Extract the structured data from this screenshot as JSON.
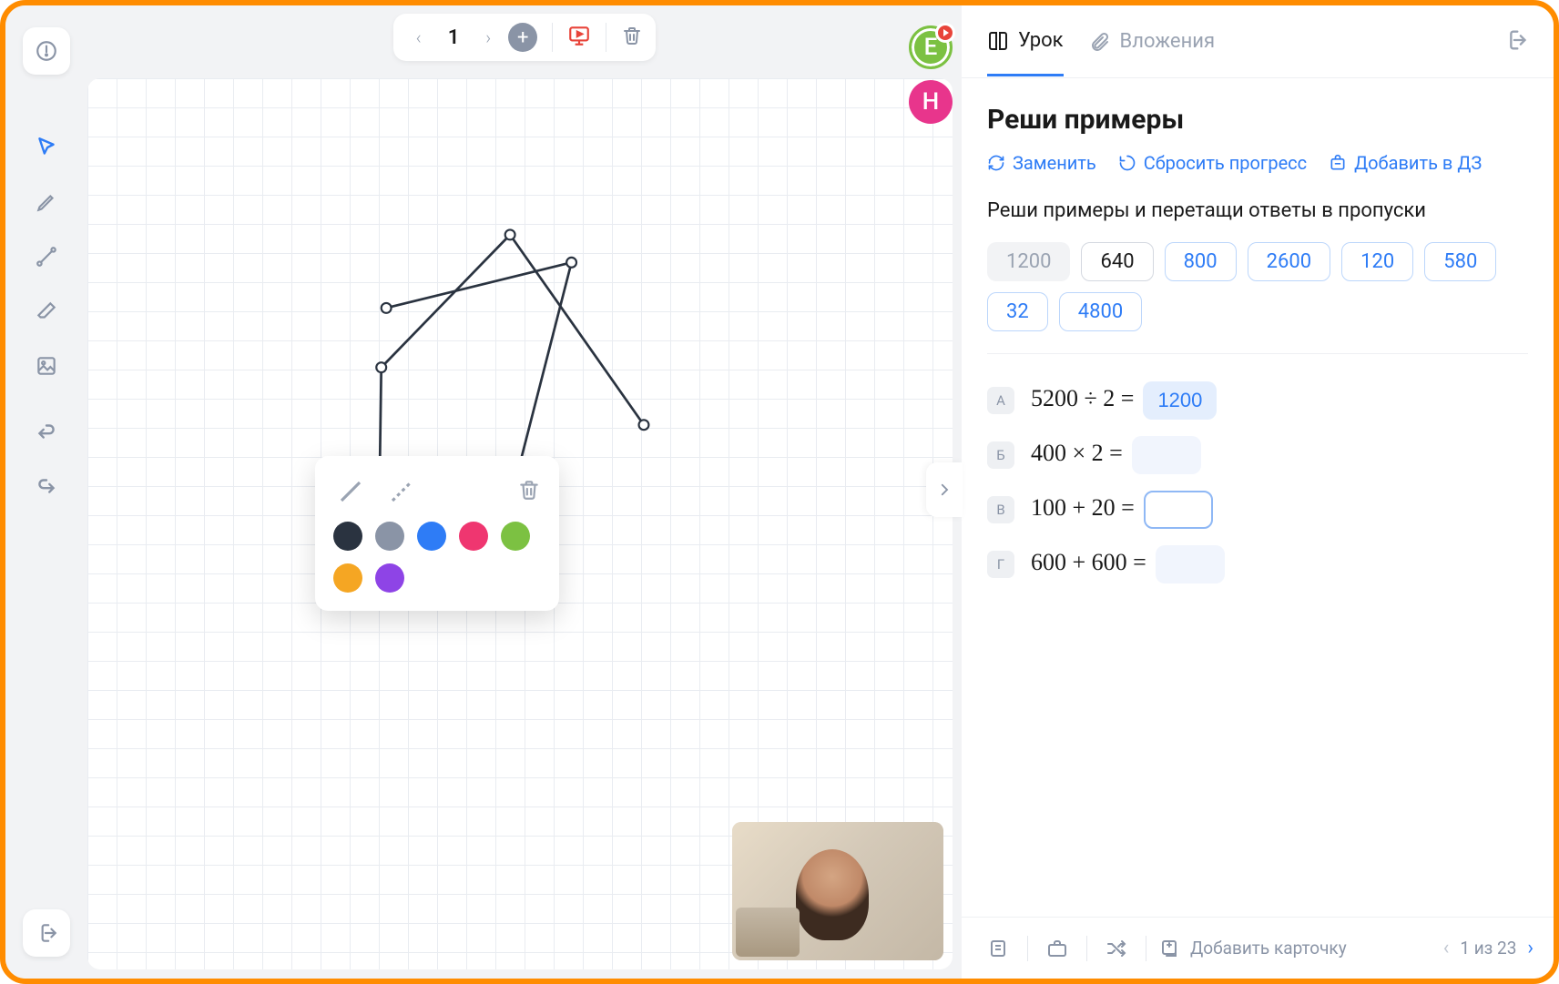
{
  "page_nav": {
    "current": "1"
  },
  "avatars": {
    "user1": "E",
    "user2": "Н"
  },
  "palette": {
    "colors": [
      "#2a3340",
      "#8a94a6",
      "#2e7cf6",
      "#ef3670",
      "#7cc142",
      "#f5a623",
      "#8e44e6"
    ]
  },
  "tabs": {
    "lesson": "Урок",
    "attachments": "Вложения"
  },
  "task": {
    "title": "Реши примеры",
    "actions": {
      "replace": "Заменить",
      "reset": "Сбросить прогресс",
      "add_to_hw": "Добавить в ДЗ"
    },
    "description": "Реши примеры и перетащи ответы в пропуски",
    "chips": [
      "1200",
      "640",
      "800",
      "2600",
      "120",
      "580",
      "32",
      "4800"
    ],
    "chip_styles": [
      "grey",
      "black",
      "blue",
      "blue",
      "blue",
      "blue",
      "blue",
      "blue"
    ],
    "problems": [
      {
        "label": "А",
        "expr": "5200 ÷ 2 =",
        "answer": "1200",
        "slot": "filled"
      },
      {
        "label": "Б",
        "expr": "400 × 2 =",
        "answer": "",
        "slot": "empty-light"
      },
      {
        "label": "В",
        "expr": "100 + 20 =",
        "answer": "",
        "slot": "empty-border"
      },
      {
        "label": "Г",
        "expr": "600 + 600 =",
        "answer": "",
        "slot": "empty-light"
      }
    ]
  },
  "footer": {
    "add_card": "Добавить карточку",
    "pagination": "1 из 23"
  }
}
